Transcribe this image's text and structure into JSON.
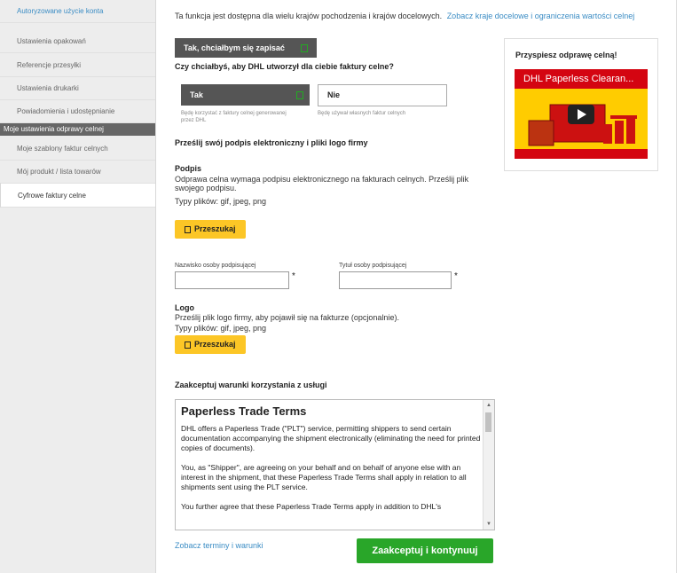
{
  "sidebar": {
    "items": [
      {
        "label": "Autoryzowane użycie konta"
      },
      {
        "label": "Ustawienia opakowań"
      },
      {
        "label": "Referencje przesyłki"
      },
      {
        "label": "Ustawienia drukarki"
      },
      {
        "label": "Powiadomienia i udostępnianie"
      }
    ],
    "section_header": "Moje ustawienia odprawy celnej",
    "section_items": [
      {
        "label": "Moje szablony faktur celnych"
      },
      {
        "label": "Mój produkt / lista towarów"
      },
      {
        "label": "Cyfrowe faktury celne"
      }
    ]
  },
  "top": {
    "info": "Ta funkcja jest dostępna dla wielu krajów pochodzenia i krajów docelowych.",
    "info_link": "Zobacz kraje docelowe i ograniczenia wartości celnej",
    "signup_button": "Tak, chciałbym się zapisać"
  },
  "invoice": {
    "question": "Czy chciałbyś, aby DHL utworzył dla ciebie faktury celne?",
    "yes_label": "Tak",
    "yes_desc": "Będę korzystać z faktury celnej generowanej przez DHL",
    "no_label": "Nie",
    "no_desc": "Będę używał własnych faktur celnych"
  },
  "upload": {
    "heading": "Prześlij swój podpis elektroniczny i pliki logo firmy",
    "signature_title": "Podpis",
    "signature_desc": "Odprawa celna wymaga podpisu elektronicznego na fakturach celnych. Prześlij plik swojego podpisu.",
    "signature_types": "Typy plików: gif, jpeg, png",
    "browse_label": "Przeszukaj",
    "signer_name_label": "Nazwisko osoby podpisującej",
    "signer_title_label": "Tytuł osoby podpisującej",
    "required_mark": "*",
    "logo_title": "Logo",
    "logo_desc": "Prześlij plik logo firmy, aby pojawił się na fakturze (opcjonalnie).",
    "logo_types": "Typy plików: gif, jpeg, png"
  },
  "terms": {
    "heading": "Zaakceptuj warunki korzystania z usługi",
    "box_title": "Paperless Trade Terms",
    "para1": "DHL offers a Paperless Trade (\"PLT\") service, permitting shippers to send certain documentation accompanying the shipment electronically (eliminating the need for printed copies of documents).",
    "para2": "You, as \"Shipper\", are agreeing on your behalf and on behalf of anyone else with an interest in the shipment, that these Paperless Trade Terms shall apply in relation to all shipments sent using the PLT service.",
    "para3": "You further agree that these Paperless Trade Terms apply in addition to DHL's",
    "view_link": "Zobacz terminy i warunki",
    "accept_button": "Zaakceptuj i kontynuuj"
  },
  "video": {
    "heading": "Przyspiesz odprawę celną!",
    "title": "DHL Paperless Clearan..."
  },
  "colors": {
    "link": "#3a8cc4",
    "yellow": "#fcc626",
    "green": "#29a629",
    "dhl_red": "#d40511",
    "dhl_yellow": "#ffcc00"
  }
}
